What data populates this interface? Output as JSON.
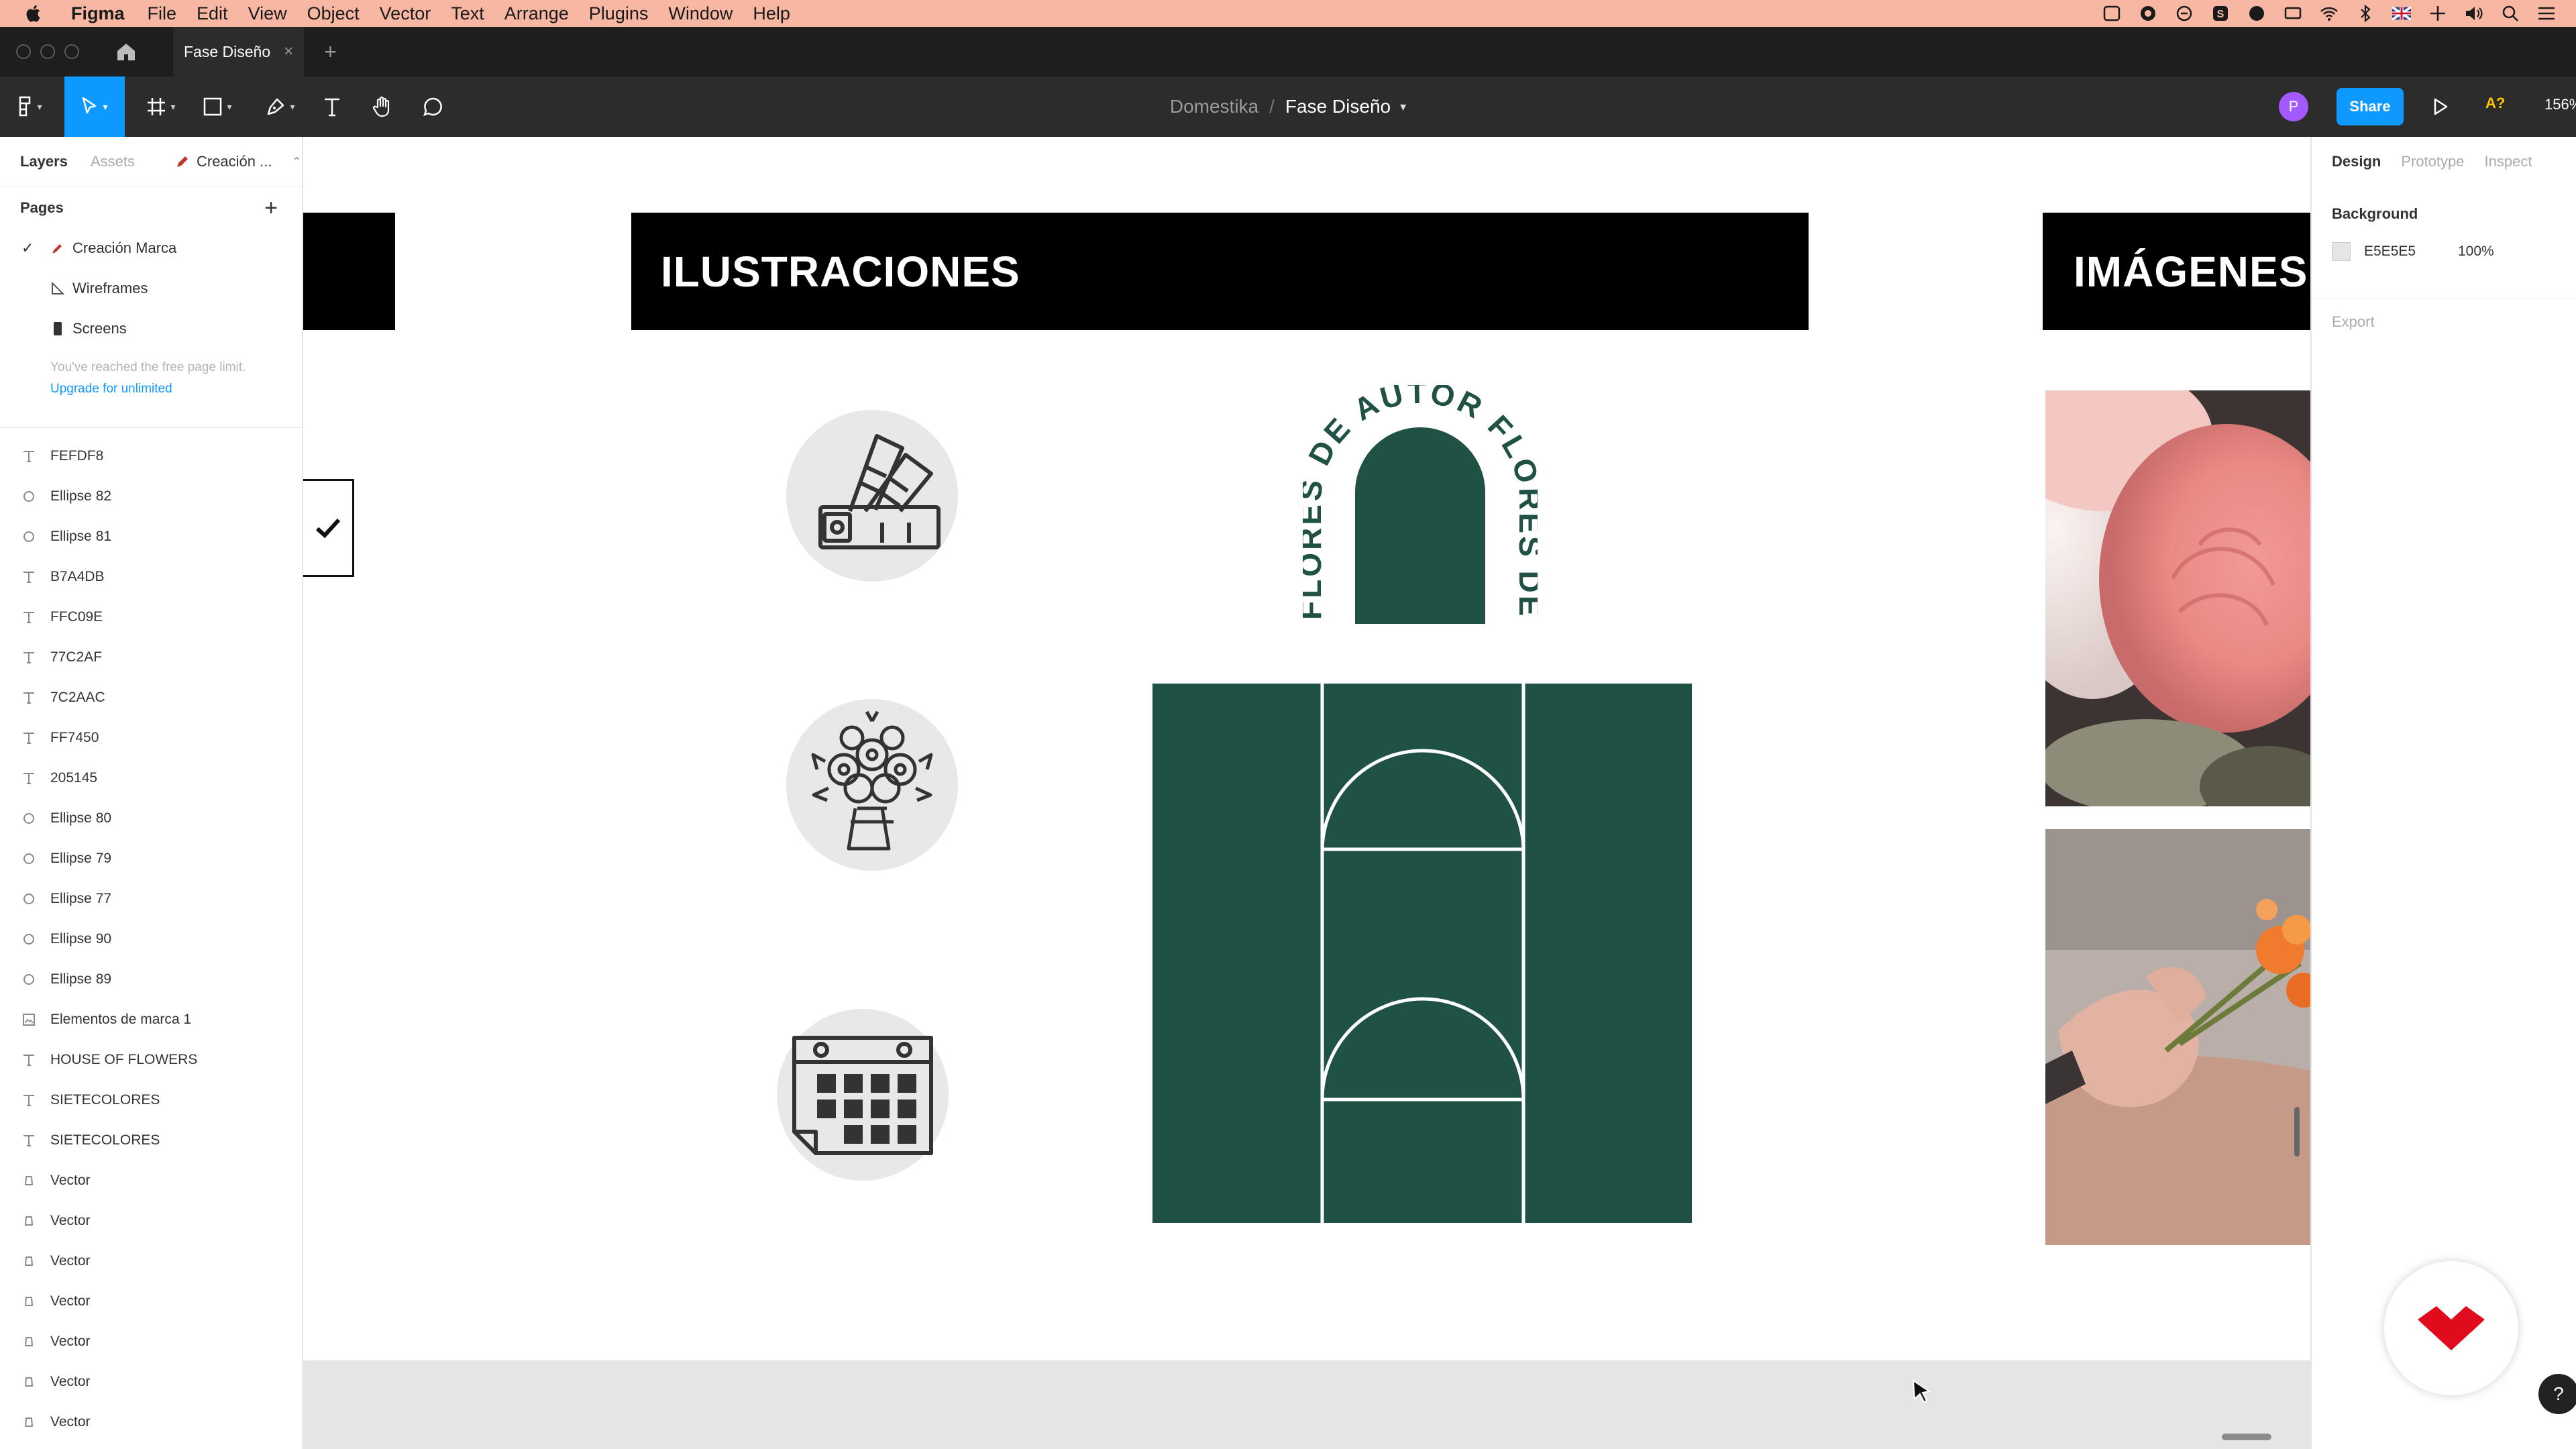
{
  "menubar": {
    "app": "Figma",
    "items": [
      "File",
      "Edit",
      "View",
      "Object",
      "Vector",
      "Text",
      "Arrange",
      "Plugins",
      "Window",
      "Help"
    ]
  },
  "tabbar": {
    "tab_title": "Fase Diseño",
    "close_glyph": "×",
    "add_glyph": "+"
  },
  "toolbar": {
    "team": "Domestika",
    "separator": "/",
    "file": "Fase Diseño",
    "avatar": "P",
    "share": "Share",
    "a_label": "A?",
    "zoom": "156%"
  },
  "left_panel": {
    "tabs": [
      "Layers",
      "Assets",
      "Creación ..."
    ],
    "pages_title": "Pages",
    "pages": [
      {
        "label": "Creación Marca",
        "selected": true
      },
      {
        "label": "Wireframes",
        "selected": false
      },
      {
        "label": "Screens",
        "selected": false
      }
    ],
    "limit_text": "You've reached the free page limit.",
    "upgrade_text": "Upgrade for unlimited",
    "layers": [
      {
        "label": "FEFDF8",
        "icon": "text-icon"
      },
      {
        "label": "Ellipse 82",
        "icon": "ellipse-icon"
      },
      {
        "label": "Ellipse 81",
        "icon": "ellipse-icon"
      },
      {
        "label": "B7A4DB",
        "icon": "text-icon"
      },
      {
        "label": "FFC09E",
        "icon": "text-icon"
      },
      {
        "label": "77C2AF",
        "icon": "text-icon"
      },
      {
        "label": "7C2AAC",
        "icon": "text-icon"
      },
      {
        "label": "FF7450",
        "icon": "text-icon"
      },
      {
        "label": "205145",
        "icon": "text-icon"
      },
      {
        "label": "Ellipse 80",
        "icon": "ellipse-icon"
      },
      {
        "label": "Ellipse 79",
        "icon": "ellipse-icon"
      },
      {
        "label": "Ellipse 77",
        "icon": "ellipse-icon"
      },
      {
        "label": "Ellipse 90",
        "icon": "ellipse-icon"
      },
      {
        "label": "Ellipse 89",
        "icon": "ellipse-icon"
      },
      {
        "label": "Elementos de marca 1",
        "icon": "image-icon"
      },
      {
        "label": "HOUSE OF FLOWERS",
        "icon": "text-icon"
      },
      {
        "label": "SIETECOLORES",
        "icon": "text-icon"
      },
      {
        "label": "SIETECOLORES",
        "icon": "text-icon"
      },
      {
        "label": "Vector",
        "icon": "vector-icon"
      },
      {
        "label": "Vector",
        "icon": "vector-icon"
      },
      {
        "label": "Vector",
        "icon": "vector-icon"
      },
      {
        "label": "Vector",
        "icon": "vector-icon"
      },
      {
        "label": "Vector",
        "icon": "vector-icon"
      },
      {
        "label": "Vector",
        "icon": "vector-icon"
      },
      {
        "label": "Vector",
        "icon": "vector-icon"
      }
    ]
  },
  "canvas": {
    "banner_illustrations": "ILUSTRACIONES",
    "banner_images": "IMÁGENES",
    "logo_text": "FLORES DE AUTOR FLORES DE AUTOR",
    "brand_green": "#205145",
    "background_color": "#E5E5E5"
  },
  "right_panel": {
    "tabs": [
      "Design",
      "Prototype",
      "Inspect"
    ],
    "background_title": "Background",
    "bg_hex": "E5E5E5",
    "bg_opacity": "100%",
    "export": "Export",
    "help": "?"
  }
}
